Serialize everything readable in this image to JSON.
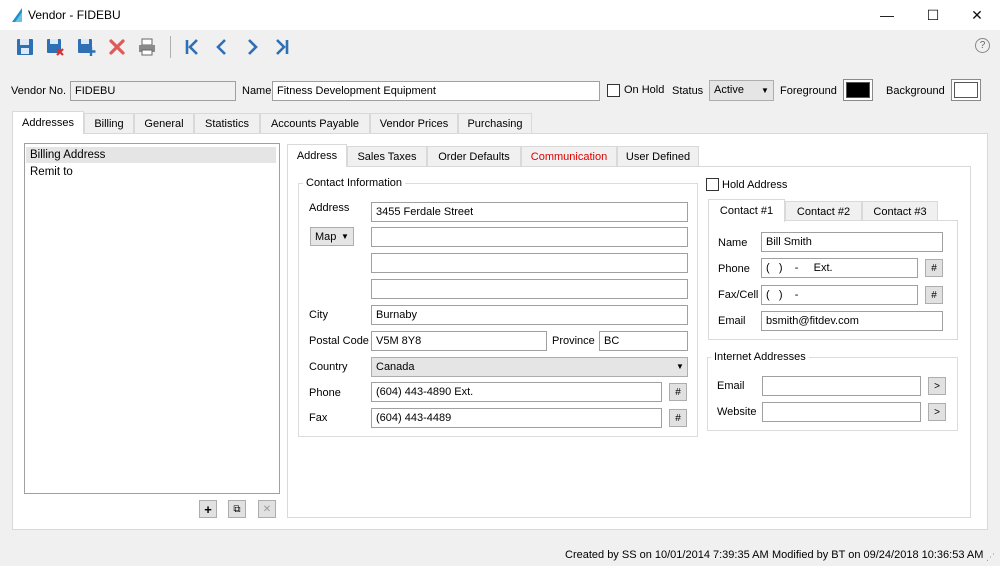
{
  "window": {
    "title": "Vendor - FIDEBU",
    "minimize": "—",
    "maximize": "☐",
    "close": "✕"
  },
  "toolbar": {
    "help": "?"
  },
  "header": {
    "vendor_no_label": "Vendor No.",
    "vendor_no_value": "FIDEBU",
    "name_label": "Name",
    "name_value": "Fitness Development Equipment",
    "on_hold_label": "On Hold",
    "status_label": "Status",
    "status_value": "Active",
    "foreground_label": "Foreground",
    "background_label": "Background",
    "foreground_color": "#000000",
    "background_color": "#ffffff"
  },
  "main_tabs": [
    "Addresses",
    "Billing",
    "General",
    "Statistics",
    "Accounts Payable",
    "Vendor Prices",
    "Purchasing"
  ],
  "address_list": {
    "items": [
      "Billing Address",
      "Remit to"
    ],
    "add": "+",
    "copy": "⧉",
    "delete": "✕"
  },
  "sub_tabs": [
    "Address",
    "Sales Taxes",
    "Order Defaults",
    "Communication",
    "User Defined"
  ],
  "communication_color": "#e00000",
  "contact_info": {
    "group_title": "Contact Information",
    "address_label": "Address",
    "address_line1": "3455 Ferdale Street",
    "address_line2": "",
    "address_line3": "",
    "address_line4": "",
    "map_label": "Map",
    "city_label": "City",
    "city_value": "Burnaby",
    "postal_label": "Postal Code",
    "postal_value": "V5M 8Y8",
    "province_label": "Province",
    "province_value": "BC",
    "country_label": "Country",
    "country_value": "Canada",
    "phone_label": "Phone",
    "phone_value": "(604) 443-4890 Ext.",
    "fax_label": "Fax",
    "fax_value": "(604) 443-4489",
    "hash": "#"
  },
  "hold_address_label": "Hold Address",
  "contact_tabs": [
    "Contact #1",
    "Contact #2",
    "Contact #3"
  ],
  "contact": {
    "name_label": "Name",
    "name_value": "Bill Smith",
    "phone_label": "Phone",
    "phone_value": "(   )    -     Ext.",
    "faxcell_label": "Fax/Cell",
    "faxcell_value": "(   )    -",
    "email_label": "Email",
    "email_value": "bsmith@fitdev.com"
  },
  "internet": {
    "group_title": "Internet Addresses",
    "email_label": "Email",
    "email_value": "",
    "website_label": "Website",
    "website_value": "",
    "go": ">"
  },
  "status_bar": {
    "created": "Created by SS on 10/01/2014 7:39:35 AM",
    "modified": "Modified by BT on 09/24/2018 10:36:53 AM"
  }
}
